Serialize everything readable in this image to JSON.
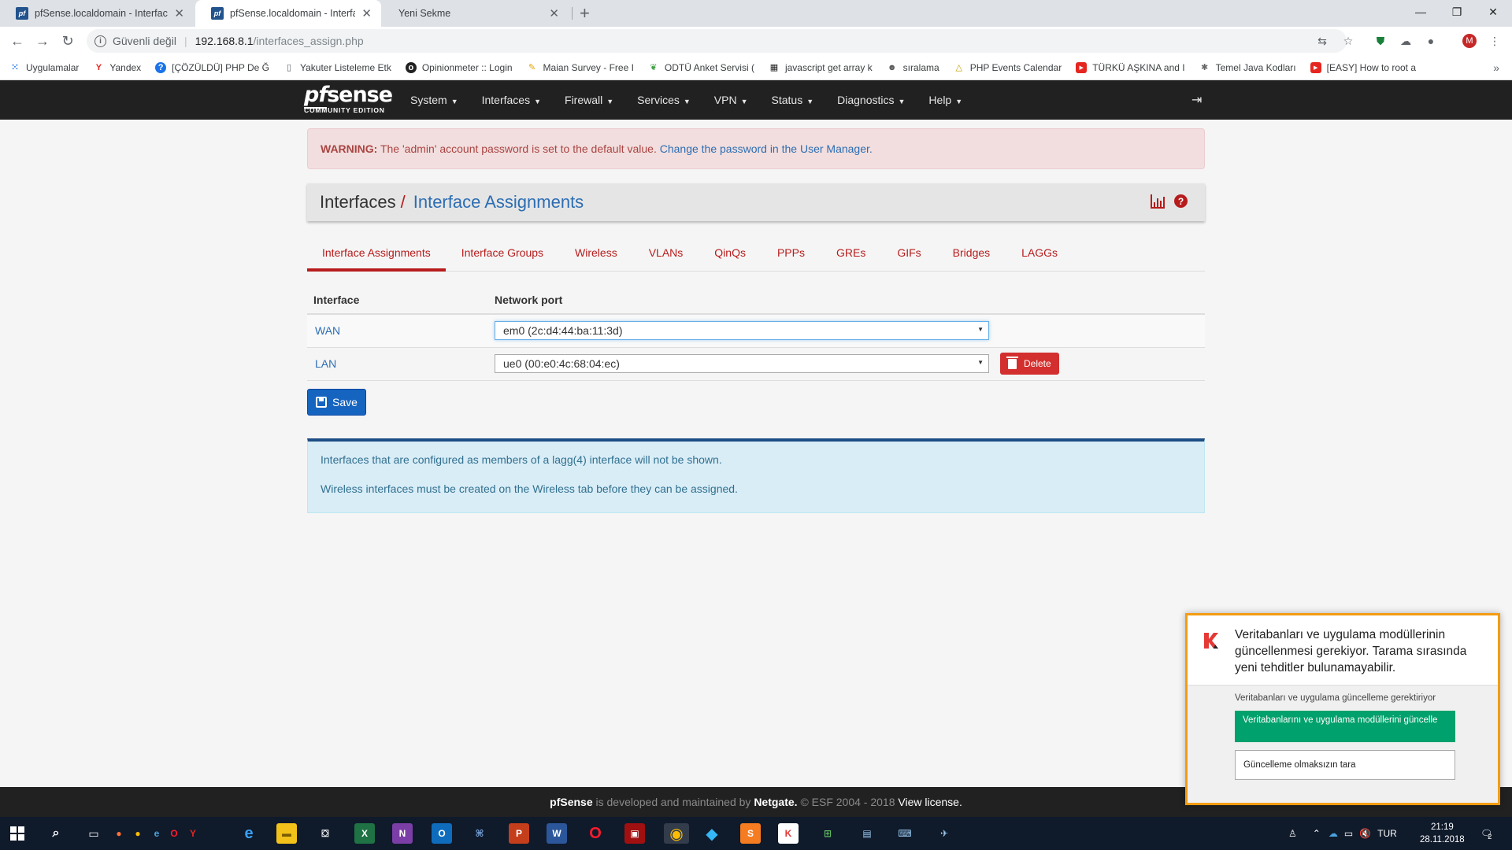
{
  "browser": {
    "tabs": [
      {
        "title": "pfSense.localdomain - Interfaces:",
        "active": false
      },
      {
        "title": "pfSense.localdomain - Interfaces:",
        "active": true
      },
      {
        "title": "Yeni Sekme",
        "active": false
      }
    ],
    "security_label": "Güvenli değil",
    "url_host": "192.168.8.1",
    "url_path": "/interfaces_assign.php",
    "profile_initial": "M",
    "bookmarks": [
      {
        "label": "Uygulamalar",
        "icon": "apps-grid-icon"
      },
      {
        "label": "Yandex",
        "icon": "yandex-icon"
      },
      {
        "label": "[ÇÖZÜLDÜ] PHP De Ğ",
        "icon": "question-icon"
      },
      {
        "label": "Yakuter Listeleme Etk",
        "icon": "page-icon"
      },
      {
        "label": "Opinionmeter :: Login",
        "icon": "opinionmeter-icon"
      },
      {
        "label": "Maian Survey - Free I",
        "icon": "pen-icon"
      },
      {
        "label": "ODTÜ Anket Servisi (",
        "icon": "leaf-icon"
      },
      {
        "label": "javascript get array k",
        "icon": "grid-icon"
      },
      {
        "label": "sıralama",
        "icon": "avatar-icon"
      },
      {
        "label": "PHP Events Calendar",
        "icon": "warning-icon"
      },
      {
        "label": "TÜRKÜ AŞKINA and I",
        "icon": "youtube-icon"
      },
      {
        "label": "Temel Java Kodları",
        "icon": "gear-icon"
      },
      {
        "label": "[EASY] How to root a",
        "icon": "youtube-icon"
      }
    ]
  },
  "nav": {
    "logo_main": "pfsense",
    "logo_pf": "pf",
    "logo_rest": "sense",
    "logo_sub": "COMMUNITY EDITION",
    "menu": [
      "System",
      "Interfaces",
      "Firewall",
      "Services",
      "VPN",
      "Status",
      "Diagnostics",
      "Help"
    ]
  },
  "warning": {
    "label": "WARNING:",
    "text": "The 'admin' account password is set to the default value.",
    "link": "Change the password in the User Manager."
  },
  "breadcrumb": {
    "parent": "Interfaces",
    "separator": "/",
    "current": "Interface Assignments"
  },
  "tabs": [
    "Interface Assignments",
    "Interface Groups",
    "Wireless",
    "VLANs",
    "QinQs",
    "PPPs",
    "GREs",
    "GIFs",
    "Bridges",
    "LAGGs"
  ],
  "table": {
    "headers": [
      "Interface",
      "Network port"
    ],
    "rows": [
      {
        "interface": "WAN",
        "port": "em0 (2c:d4:44:ba:11:3d)",
        "delete": false
      },
      {
        "interface": "LAN",
        "port": "ue0 (00:e0:4c:68:04:ec)",
        "delete": true
      }
    ],
    "delete_label": "Delete",
    "save_label": "Save"
  },
  "info": [
    "Interfaces that are configured as members of a lagg(4) interface will not be shown.",
    "Wireless interfaces must be created on the Wireless tab before they can be assigned."
  ],
  "footer": {
    "brand": "pfSense",
    "text1": "is developed and maintained by",
    "company": "Netgate.",
    "text2": "© ESF 2004 - 2018",
    "license": "View license."
  },
  "kaspersky": {
    "message": "Veritabanları ve uygulama modüllerinin güncellenmesi gerekiyor. Tarama sırasında yeni tehditler bulunamayabilir.",
    "subtitle": "Veritabanları ve uygulama güncelleme gerektiriyor",
    "primary_button": "Veritabanlarını ve uygulama modüllerini güncelle",
    "secondary_button": "Güncelleme olmaksızın tara"
  },
  "taskbar": {
    "language": "TUR",
    "time": "21:19",
    "date": "28.11.2018",
    "notifications": "2"
  },
  "colors": {
    "pfsense_red": "#b71c1c",
    "link_blue": "#2c6db3",
    "save_blue": "#1565c0",
    "navbar": "#212121",
    "kaspersky_green": "#00a16c",
    "kaspersky_border": "#f39c12"
  }
}
